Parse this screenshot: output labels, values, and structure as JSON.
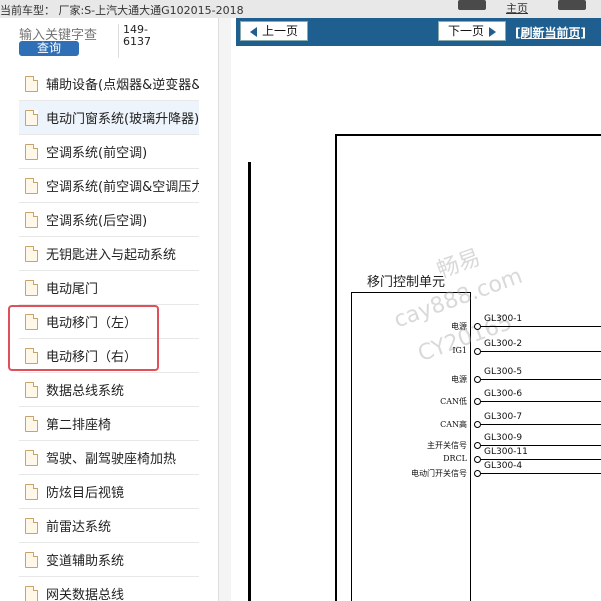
{
  "topbar": {
    "text": "当前车型：  厂家:S-上汽大通大通G102015-2018",
    "right_word": "主页"
  },
  "search": {
    "placeholder": "输入关键字查",
    "button_label": "查询",
    "code": "149-6137"
  },
  "nav": {
    "items": [
      {
        "label": "辅助设备(点烟器&逆变器&诊断"
      },
      {
        "label": "电动门窗系统(玻璃升降器)"
      },
      {
        "label": "空调系统(前空调)"
      },
      {
        "label": "空调系统(前空调&空调压力开关"
      },
      {
        "label": "空调系统(后空调)"
      },
      {
        "label": "无钥匙进入与起动系统"
      },
      {
        "label": "电动尾门"
      },
      {
        "label": "电动移门（左）"
      },
      {
        "label": "电动移门（右）"
      },
      {
        "label": "数据总线系统"
      },
      {
        "label": "第二排座椅"
      },
      {
        "label": "驾驶、副驾驶座椅加热"
      },
      {
        "label": "防炫目后视镜"
      },
      {
        "label": "前雷达系统"
      },
      {
        "label": "变道辅助系统"
      },
      {
        "label": "网关数据总线"
      }
    ]
  },
  "toolbar": {
    "prev_label": "上一页",
    "next_label": "下一页",
    "refresh_label": "[刷新当前页]"
  },
  "diagram": {
    "module_title": "移门控制单元",
    "pins": [
      {
        "label": "电源",
        "code": "GL300-1"
      },
      {
        "label": "IG1",
        "code": "GL300-2"
      },
      {
        "label": "电源",
        "code": "GL300-5"
      },
      {
        "label": "CAN低",
        "code": "GL300-6"
      },
      {
        "label": "CAN高",
        "code": "GL300-7"
      },
      {
        "label": "主开关信号",
        "code": "GL300-9"
      },
      {
        "label": "DRCL",
        "code": "GL300-11"
      },
      {
        "label": "电动门开关信号",
        "code": "GL300-4"
      }
    ],
    "watermark": [
      "畅易",
      "cay888.com",
      "CY20165"
    ]
  },
  "colors": {
    "toolbar_bg": "#1f5f8f",
    "search_button": "#2f6fb6",
    "highlight_box": "#e0505a"
  }
}
